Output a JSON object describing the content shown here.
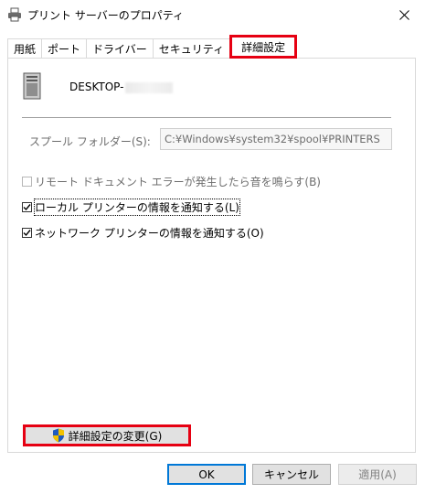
{
  "window": {
    "title": "プリント サーバーのプロパティ"
  },
  "tabs": [
    {
      "label": "用紙"
    },
    {
      "label": "ポート"
    },
    {
      "label": "ドライバー"
    },
    {
      "label": "セキュリティ"
    },
    {
      "label": "詳細設定",
      "active": true
    }
  ],
  "server": {
    "name": "DESKTOP-"
  },
  "spool": {
    "label": "スプール フォルダー(S):",
    "value": "C:¥Windows¥system32¥spool¥PRINTERS"
  },
  "options": [
    {
      "label": "リモート ドキュメント エラーが発生したら音を鳴らす(B)",
      "checked": false,
      "enabled": false
    },
    {
      "label": "ローカル プリンターの情報を通知する(L)",
      "checked": true,
      "enabled": true
    },
    {
      "label": "ネットワーク プリンターの情報を通知する(O)",
      "checked": true,
      "enabled": true
    }
  ],
  "buttons": {
    "change_settings": "詳細設定の変更(G)",
    "ok": "OK",
    "cancel": "キャンセル",
    "apply": "適用(A)"
  },
  "colors": {
    "highlight": "#e60012",
    "focus": "#0078d7"
  }
}
